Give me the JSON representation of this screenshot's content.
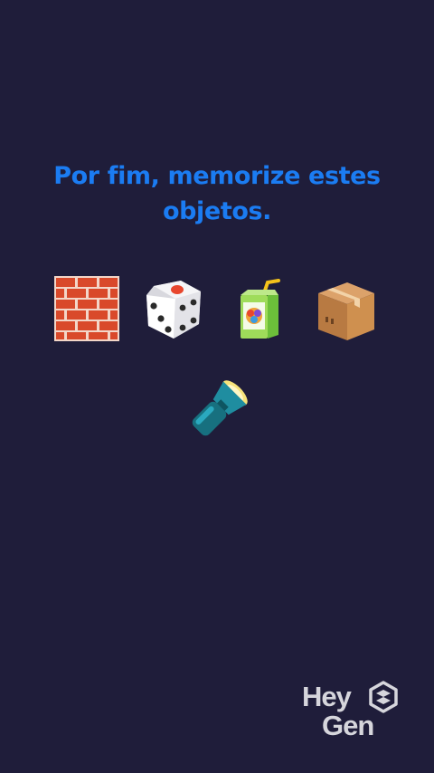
{
  "prompt": {
    "title": "Por fim, memorize estes objetos."
  },
  "objects": [
    {
      "name": "brick-wall",
      "icon": "brick-icon"
    },
    {
      "name": "die",
      "icon": "dice-icon"
    },
    {
      "name": "juice-box",
      "icon": "juice-box-icon"
    },
    {
      "name": "package",
      "icon": "package-icon"
    },
    {
      "name": "flashlight",
      "icon": "flashlight-icon"
    }
  ],
  "branding": {
    "line1": "Hey",
    "line2": "Gen"
  },
  "colors": {
    "background": "#1f1d3a",
    "title": "#1b7cf2",
    "logo": "#d6d6dc"
  }
}
